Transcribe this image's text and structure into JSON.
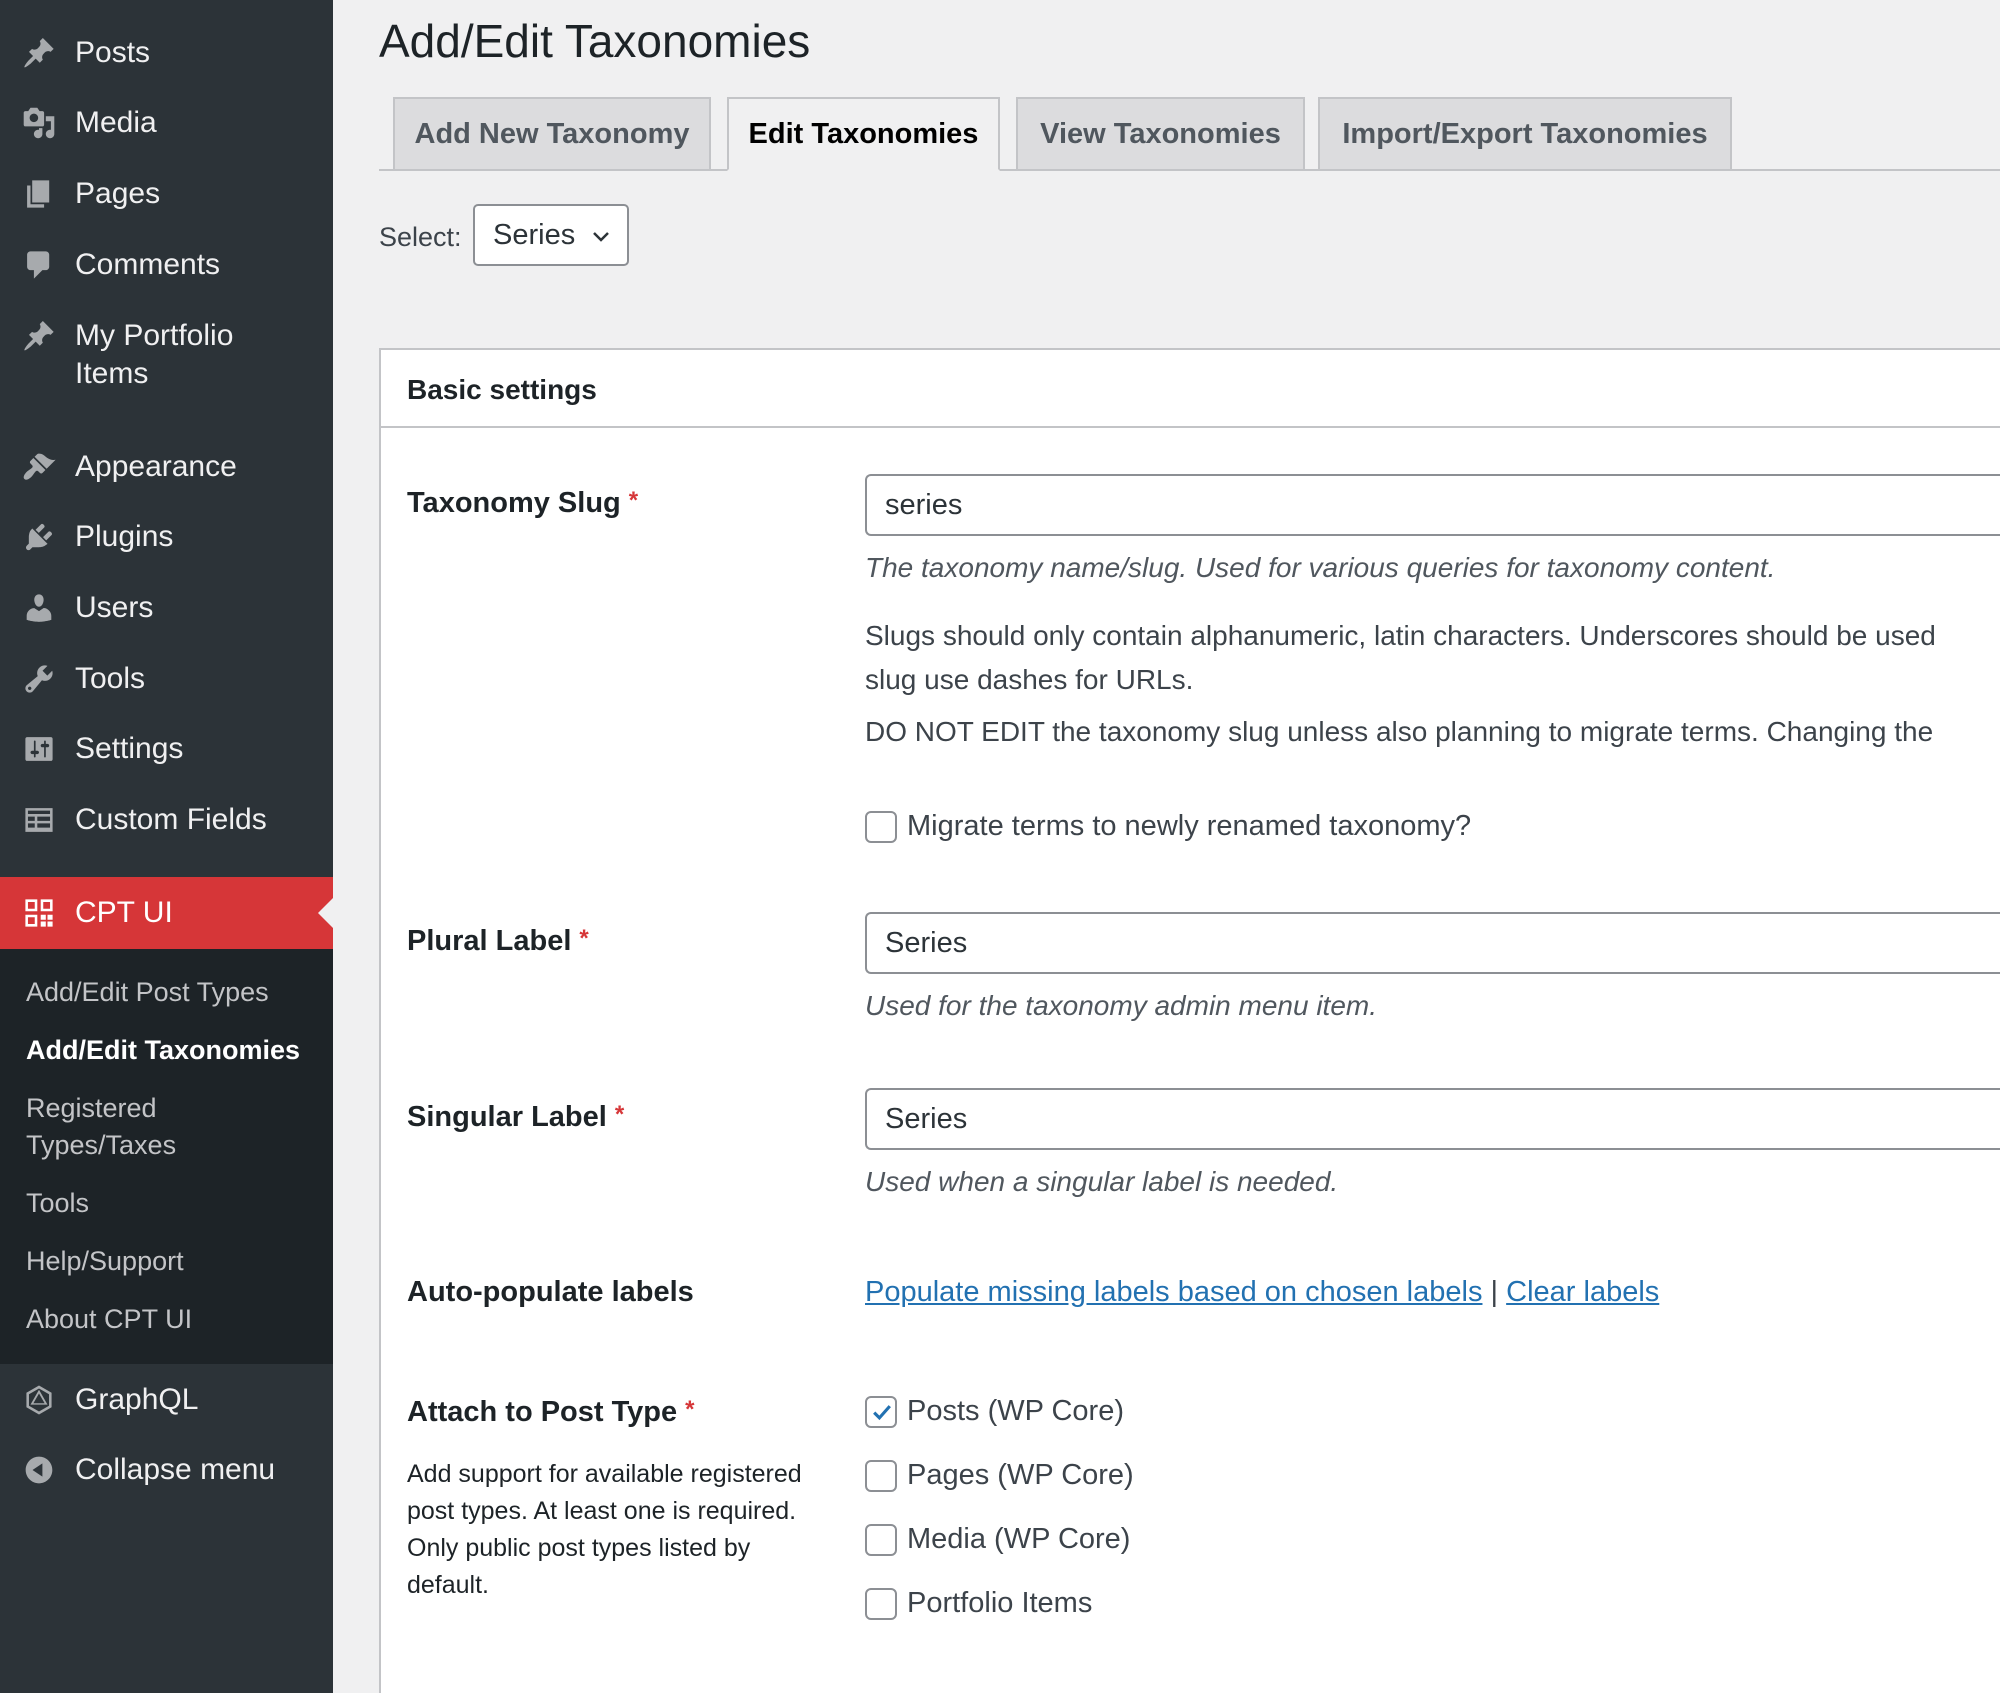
{
  "sidebar": {
    "menu": [
      {
        "label": "Posts",
        "icon": "pushpin-icon"
      },
      {
        "label": "Media",
        "icon": "media-icon"
      },
      {
        "label": "Pages",
        "icon": "pages-icon"
      },
      {
        "label": "Comments",
        "icon": "comment-icon"
      },
      {
        "label": "My Portfolio Items",
        "icon": "pushpin-icon"
      },
      {
        "label": "Appearance",
        "icon": "brush-icon"
      },
      {
        "label": "Plugins",
        "icon": "plugin-icon"
      },
      {
        "label": "Users",
        "icon": "user-icon"
      },
      {
        "label": "Tools",
        "icon": "wrench-icon"
      },
      {
        "label": "Settings",
        "icon": "sliders-icon"
      },
      {
        "label": "Custom Fields",
        "icon": "table-icon"
      }
    ],
    "active": {
      "label": "CPT UI",
      "icon": "grid-icon"
    },
    "submenu": [
      "Add/Edit Post Types",
      "Add/Edit Taxonomies",
      "Registered Types/Taxes",
      "Tools",
      "Help/Support",
      "About CPT UI"
    ],
    "current_submenu": "Add/Edit Taxonomies",
    "bottom": [
      {
        "label": "GraphQL",
        "icon": "graphql-icon"
      },
      {
        "label": "Collapse menu",
        "icon": "collapse-arrow-icon"
      }
    ]
  },
  "page": {
    "title": "Add/Edit Taxonomies",
    "tabs": [
      "Add New Taxonomy",
      "Edit Taxonomies",
      "View Taxonomies",
      "Import/Export Taxonomies"
    ],
    "active_tab": "Edit Taxonomies",
    "select_label": "Select:",
    "select_value": "Series"
  },
  "panel": {
    "title": "Basic settings",
    "slug": {
      "label": "Taxonomy Slug",
      "required": "*",
      "value": "series",
      "help": "The taxonomy name/slug. Used for various queries for taxonomy content.",
      "note1a": "Slugs should only contain alphanumeric, latin characters. Underscores should be used",
      "note1b": "slug use dashes for URLs.",
      "note2": "DO NOT EDIT the taxonomy slug unless also planning to migrate terms. Changing the",
      "migrate_label": "Migrate terms to newly renamed taxonomy?",
      "migrate_checked": false
    },
    "plural": {
      "label": "Plural Label",
      "required": "*",
      "value": "Series",
      "help": "Used for the taxonomy admin menu item."
    },
    "singular": {
      "label": "Singular Label",
      "required": "*",
      "value": "Series",
      "help": "Used when a singular label is needed."
    },
    "autopop": {
      "label": "Auto-populate labels",
      "populate_link": "Populate missing labels based on chosen labels",
      "separator": "|",
      "clear_link": "Clear labels"
    },
    "attach": {
      "label": "Attach to Post Type",
      "required": "*",
      "desc": "Add support for available registered post types. At least one is required. Only public post types listed by default.",
      "options": [
        {
          "label": "Posts (WP Core)",
          "checked": true
        },
        {
          "label": "Pages (WP Core)",
          "checked": false
        },
        {
          "label": "Media (WP Core)",
          "checked": false
        },
        {
          "label": "Portfolio Items",
          "checked": false
        }
      ]
    }
  },
  "colors": {
    "sidebar_bg": "#2c3338",
    "submenu_bg": "#1d2327",
    "active_menu": "#d63638",
    "link": "#2271b1",
    "required": "#d63638"
  }
}
